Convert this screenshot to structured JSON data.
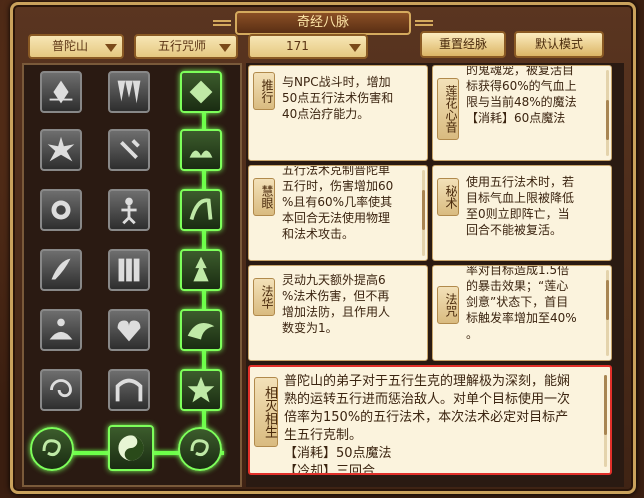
{
  "window": {
    "title": "奇经八脉"
  },
  "filters": {
    "school": "普陀山",
    "faction": "五行咒师",
    "level": "171"
  },
  "buttons": {
    "reset": "重置经脉",
    "default": "默认模式"
  },
  "skills": [
    {
      "id": "tuixing",
      "label": "推行",
      "text": "与NPC战斗时，增加\n50点五行法术伤害和\n40点治疗能力。"
    },
    {
      "id": "lianhuaxinyin",
      "label": "莲花心音",
      "text": "的鬼魂宠，被复活目\n标获得60%的气血上\n限与当前48%的魔法\n【消耗】60点魔法"
    },
    {
      "id": "huiyan",
      "label": "慧眼",
      "text": "五行法术克制普陀单\n五行时，伤害增加60\n%且有60%几率使其\n本回合无法使用物理\n和法术攻击。"
    },
    {
      "id": "mishu",
      "label": "秘术",
      "text": "使用五行法术时，若\n目标气血上限被降低\n至0则立即阵亡，当\n回合不能被复活。"
    },
    {
      "id": "fahua",
      "label": "法华",
      "text": "灵动九天额外提高6\n%法术伤害，但不再\n增加法防，且作用人\n数变为1。"
    },
    {
      "id": "fazhou",
      "label": "法咒",
      "text": "率对目标造成1.5倍\n的暴击效果；“莲心\n剑意”状态下，首目\n标触发率增加至40%\n。"
    }
  ],
  "selected": {
    "label": "相灭相生",
    "text": "普陀山的弟子对于五行生克的理解极为深刻，能娴\n熟的运转五行进而惩治敌人。对单个目标使用一次\n倍率为150%的五行法术，本次法术必定对目标产\n生五行克制。\n【消耗】50点魔法\n【冷却】三回合"
  },
  "icons": [
    "lotus-rise-icon",
    "stalactite-icon",
    "scroll-diamond-icon",
    "burst-icon",
    "bell-hammer-icon",
    "lotus-seat-icon",
    "flame-lotus-icon",
    "monk-icon",
    "kneeling-sage-icon",
    "orchid-icon",
    "talisman-icon",
    "stupa-icon",
    "lotus-meditate-icon",
    "heart-shards-icon",
    "wave-crest-icon",
    "spiral-icon",
    "gate-icon",
    "star-seal-icon",
    "swirl-orb-left-icon",
    "taiji-icon",
    "swirl-orb-right-icon"
  ]
}
